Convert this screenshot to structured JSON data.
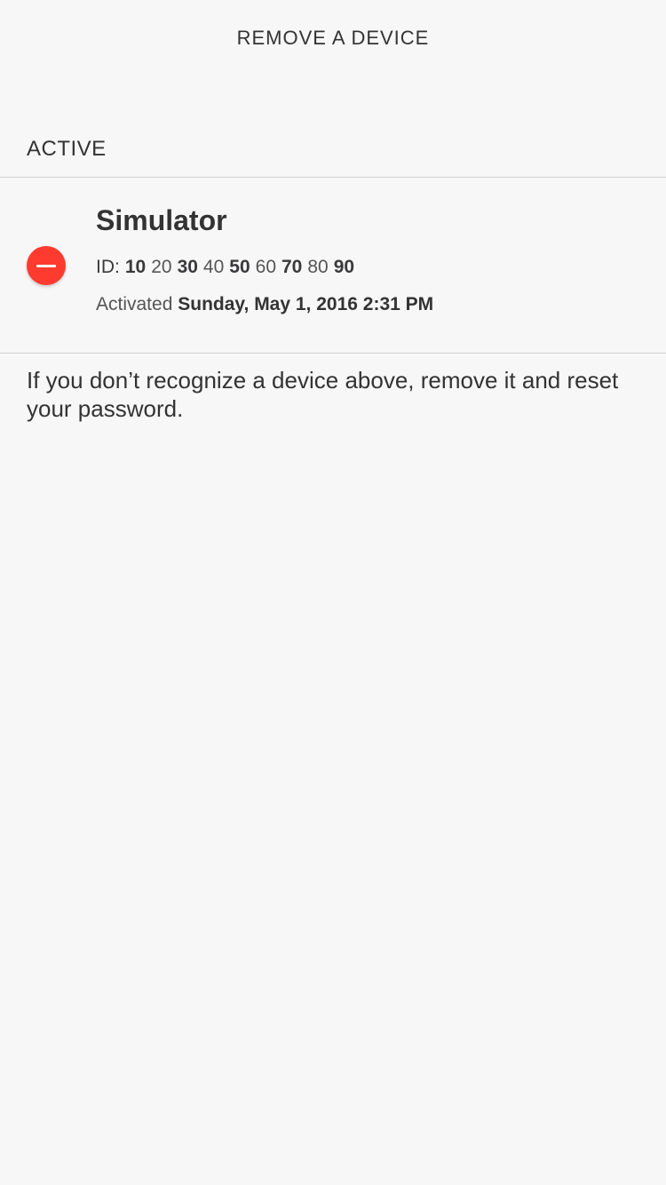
{
  "nav": {
    "title": "REMOVE A DEVICE"
  },
  "section": {
    "header": "ACTIVE"
  },
  "device": {
    "name": "Simulator",
    "id_label": "ID:",
    "id_segments": [
      "10",
      "20",
      "30",
      "40",
      "50",
      "60",
      "70",
      "80",
      "90"
    ],
    "activated_label": "Activated",
    "activated_date": "Sunday, May 1, 2016 2:31 PM",
    "remove_icon": "minus-circle-icon"
  },
  "help": {
    "text": "If you don’t recognize a device above, remove it and reset your password."
  },
  "colors": {
    "background": "#f7f7f7",
    "destructive": "#ff3b30",
    "text": "#333333",
    "divider": "#cfcfcf"
  }
}
